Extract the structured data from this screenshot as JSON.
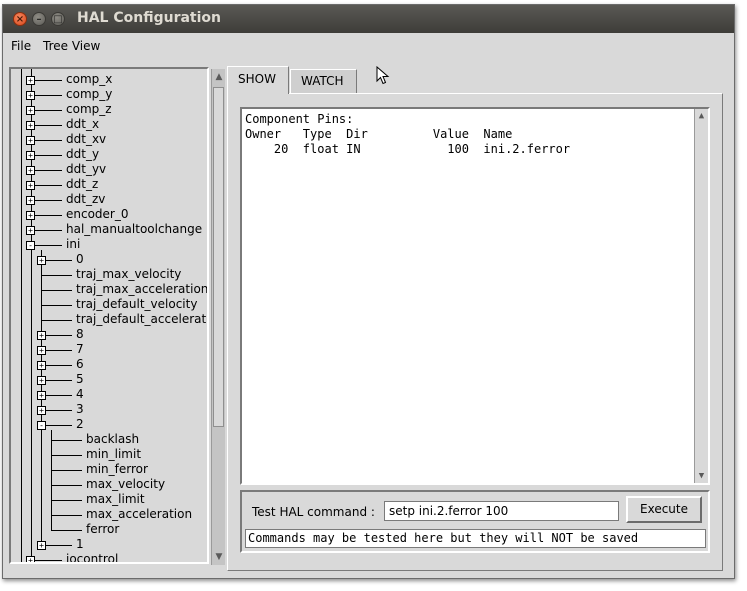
{
  "window": {
    "title": "HAL Configuration",
    "close_glyph": "×",
    "min_glyph": "–",
    "max_glyph": "□"
  },
  "menu": {
    "file": "File",
    "tree_view": "Tree View"
  },
  "tree": {
    "items": [
      {
        "label": "comp_x",
        "depth": 1,
        "expander": "+"
      },
      {
        "label": "comp_y",
        "depth": 1,
        "expander": "+"
      },
      {
        "label": "comp_z",
        "depth": 1,
        "expander": "+"
      },
      {
        "label": "ddt_x",
        "depth": 1,
        "expander": "+"
      },
      {
        "label": "ddt_xv",
        "depth": 1,
        "expander": "+"
      },
      {
        "label": "ddt_y",
        "depth": 1,
        "expander": "+"
      },
      {
        "label": "ddt_yv",
        "depth": 1,
        "expander": "+"
      },
      {
        "label": "ddt_z",
        "depth": 1,
        "expander": "+"
      },
      {
        "label": "ddt_zv",
        "depth": 1,
        "expander": "+"
      },
      {
        "label": "encoder_0",
        "depth": 1,
        "expander": "+"
      },
      {
        "label": "hal_manualtoolchange",
        "depth": 1,
        "expander": "+"
      },
      {
        "label": "ini",
        "depth": 1,
        "expander": "-"
      },
      {
        "label": "0",
        "depth": 2,
        "expander": "+"
      },
      {
        "label": "traj_max_velocity",
        "depth": 2,
        "expander": ""
      },
      {
        "label": "traj_max_acceleration",
        "depth": 2,
        "expander": ""
      },
      {
        "label": "traj_default_velocity",
        "depth": 2,
        "expander": ""
      },
      {
        "label": "traj_default_acceleration",
        "depth": 2,
        "expander": ""
      },
      {
        "label": "8",
        "depth": 2,
        "expander": "+"
      },
      {
        "label": "7",
        "depth": 2,
        "expander": "+"
      },
      {
        "label": "6",
        "depth": 2,
        "expander": "+"
      },
      {
        "label": "5",
        "depth": 2,
        "expander": "+"
      },
      {
        "label": "4",
        "depth": 2,
        "expander": "+"
      },
      {
        "label": "3",
        "depth": 2,
        "expander": "+"
      },
      {
        "label": "2",
        "depth": 2,
        "expander": "-"
      },
      {
        "label": "backlash",
        "depth": 3,
        "expander": ""
      },
      {
        "label": "min_limit",
        "depth": 3,
        "expander": ""
      },
      {
        "label": "min_ferror",
        "depth": 3,
        "expander": ""
      },
      {
        "label": "max_velocity",
        "depth": 3,
        "expander": ""
      },
      {
        "label": "max_limit",
        "depth": 3,
        "expander": ""
      },
      {
        "label": "max_acceleration",
        "depth": 3,
        "expander": ""
      },
      {
        "label": "ferror",
        "depth": 3,
        "expander": ""
      },
      {
        "label": "1",
        "depth": 2,
        "expander": "+"
      },
      {
        "label": "iocontrol",
        "depth": 1,
        "expander": "+"
      }
    ]
  },
  "tabs": {
    "show": "SHOW",
    "watch": "WATCH"
  },
  "output": {
    "heading": "Component Pins:",
    "columns": "Owner   Type  Dir         Value  Name",
    "rows": [
      "    20  float IN            100  ini.2.ferror"
    ]
  },
  "command": {
    "label": "Test HAL command :",
    "input_value": "setp ini.2.ferror 100",
    "execute_label": "Execute",
    "message": "Commands may be tested here but they will NOT be saved"
  },
  "scroll_glyphs": {
    "up": "▲",
    "down": "▼"
  }
}
